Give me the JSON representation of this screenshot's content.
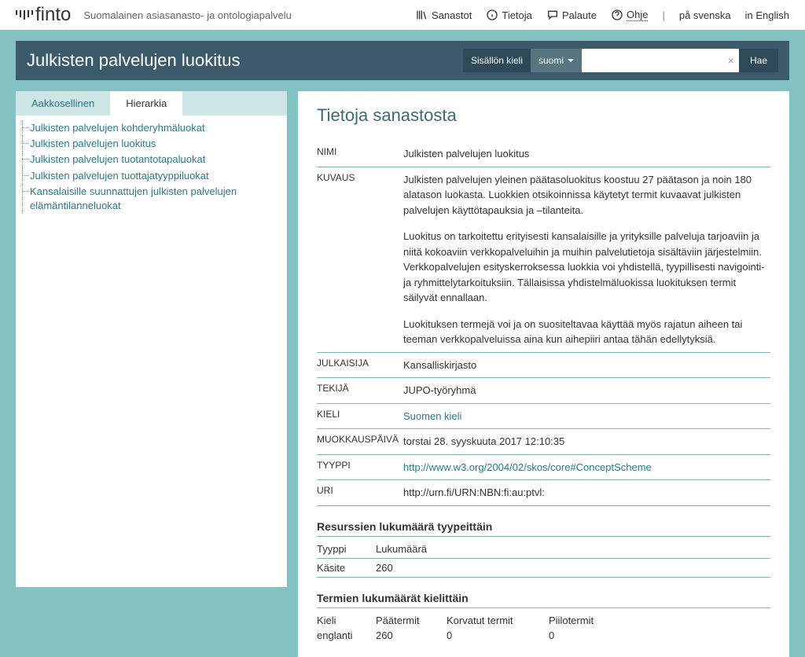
{
  "header": {
    "logo": "finto",
    "tagline": "Suomalainen asiasanasto- ja ontologiapalvelu",
    "links": {
      "vocabularies": "Sanastot",
      "info": "Tietoja",
      "feedback": "Palaute",
      "help": "Ohje"
    },
    "lang_sv": "på svenska",
    "lang_en": "in English"
  },
  "titlebar": {
    "title": "Julkisten palvelujen luokitus",
    "content_lang_label": "Sisällön kieli",
    "content_lang_value": "suomi",
    "search_placeholder": "",
    "search_button": "Hae"
  },
  "sidebar": {
    "tabs": {
      "alpha": "Aakkosellinen",
      "hier": "Hierarkia"
    },
    "tree": [
      "Julkisten palvelujen kohderyhmäluokat",
      "Julkisten palvelujen luokitus",
      "Julkisten palvelujen tuotantotapaluokat",
      "Julkisten palvelujen tuottajatyyppiluokat",
      "Kansalaisille suunnattujen julkisten palvelujen elämäntilanneluokat"
    ]
  },
  "content": {
    "heading": "Tietoja sanastosta",
    "labels": {
      "nimi": "NIMI",
      "kuvaus": "KUVAUS",
      "julkaisija": "JULKAISIJA",
      "tekija": "TEKIJÄ",
      "kieli": "KIELI",
      "muokkaus": "MUOKKAUSPÄIVÄ",
      "tyyppi": "TYYPPI",
      "uri": "URI"
    },
    "nimi": "Julkisten palvelujen luokitus",
    "kuvaus_p1": "Julkisten palvelujen yleinen päätasoluokitus koostuu 27 päätason ja noin 180 alatason luokasta. Luokkien otsikoinnissa käytetyt termit kuvaavat julkisten palvelujen käyttötapauksia ja –tilanteita.",
    "kuvaus_p2": "Luokitus on tarkoitettu erityisesti kansalaisille ja yrityksille palveluja tarjoaviin ja niitä kokoaviin verkkopalveluihin ja muihin palvelutietoja sisältäviin järjestelmiin. Verkkopalvelujen esityskerroksessa luokkia voi yhdistellä, tyypillisesti navigointi- ja ryhmittelytarkoituksiin. Tällaisissa yhdistelmäluokissa luokituksen termit säilyvät ennallaan.",
    "kuvaus_p3": "Luokituksen termejä voi ja on suositeltavaa käyttää myös rajatun aiheen tai teeman verkkopalveluissa aina kun aihepiiri antaa tähän edellytyksiä.",
    "julkaisija": "Kansalliskirjasto",
    "tekija": "JUPO-työryhmä",
    "kieli": "Suomen kieli",
    "muokkaus": "torstai 28. syyskuuta 2017 12:10:35",
    "tyyppi": "http://www.w3.org/2004/02/skos/core#ConceptScheme",
    "uri": "http://urn.fi/URN:NBN:fi:au:ptvl:",
    "res_heading": "Resurssien lukumäärä tyypeittäin",
    "res_table": {
      "h1": "Tyyppi",
      "h2": "Lukumäärä",
      "r1c1": "Käsite",
      "r1c2": "260"
    },
    "term_heading": "Termien lukumäärät kielittäin",
    "term_table": {
      "h1": "Kieli",
      "h2": "Päätermit",
      "h3": "Korvatut termit",
      "h4": "Piilotermit",
      "r1c1": "englanti",
      "r1c2": "260",
      "r1c3": "0",
      "r1c4": "0"
    }
  }
}
